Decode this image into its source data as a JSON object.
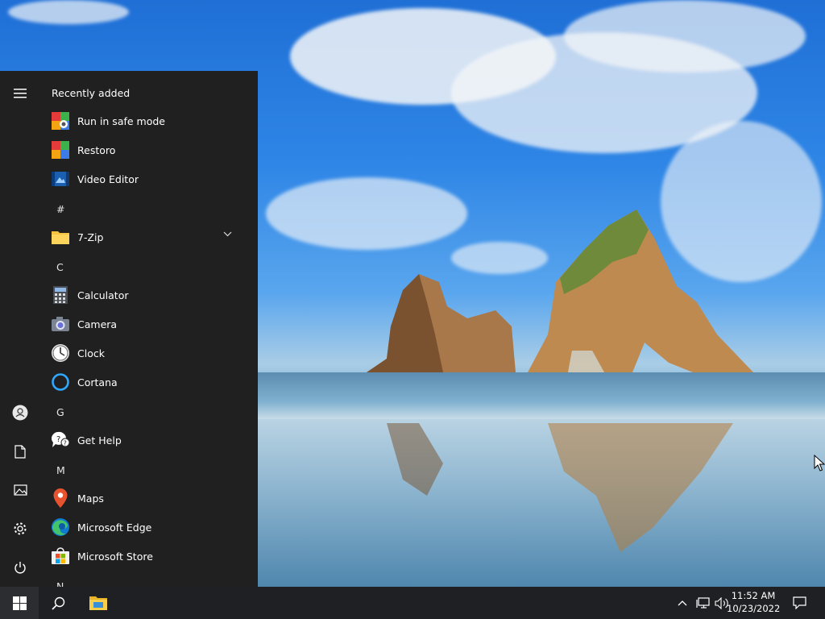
{
  "start_menu": {
    "section_title": "Recently added",
    "recent_apps": [
      {
        "label": "Run in safe mode",
        "icon": "run-safe-mode-icon"
      },
      {
        "label": "Restoro",
        "icon": "restoro-icon"
      },
      {
        "label": "Video Editor",
        "icon": "video-editor-icon"
      }
    ],
    "groups": [
      {
        "letter": "#",
        "apps": [
          {
            "label": "7-Zip",
            "icon": "folder-icon",
            "expandable": true
          }
        ]
      },
      {
        "letter": "C",
        "apps": [
          {
            "label": "Calculator",
            "icon": "calculator-icon"
          },
          {
            "label": "Camera",
            "icon": "camera-icon"
          },
          {
            "label": "Clock",
            "icon": "clock-icon"
          },
          {
            "label": "Cortana",
            "icon": "cortana-icon"
          }
        ]
      },
      {
        "letter": "G",
        "apps": [
          {
            "label": "Get Help",
            "icon": "get-help-icon"
          }
        ]
      },
      {
        "letter": "M",
        "apps": [
          {
            "label": "Maps",
            "icon": "maps-icon"
          },
          {
            "label": "Microsoft Edge",
            "icon": "edge-icon"
          },
          {
            "label": "Microsoft Store",
            "icon": "store-icon"
          }
        ]
      },
      {
        "letter": "N",
        "apps": []
      }
    ],
    "rail": [
      "hamburger-icon",
      "user-icon",
      "documents-icon",
      "pictures-icon",
      "settings-icon",
      "power-icon"
    ]
  },
  "taskbar": {
    "time": "11:52 AM",
    "date": "10/23/2022",
    "icons": [
      "windows-start-icon",
      "search-icon",
      "file-explorer-icon",
      "chevron-up-icon",
      "network-icon",
      "volume-icon",
      "notification-icon"
    ]
  },
  "colors": {
    "start_bg": "#202020",
    "taskbar_bg": "#1e2023",
    "accent": "#0078d7"
  }
}
